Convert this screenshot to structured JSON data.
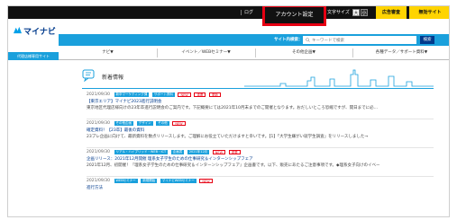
{
  "topbar": {
    "login": "ログ",
    "account": "アカウント設定",
    "font_size_label": "文字サイズ",
    "size_large": "大",
    "size_small": "小",
    "ad_button": "広告審査",
    "other_button": "無効サイト"
  },
  "header": {
    "logo_text": "マイナビ",
    "site_label": "代理店様専用サイト",
    "search_label": "サイト内検索：",
    "search_placeholder": "キーワードで検索",
    "search_button": "検索"
  },
  "nav": [
    {
      "label": "ナビ▼"
    },
    {
      "label": "イベント／WEBセミナー▼"
    },
    {
      "label": "その他企画▼"
    },
    {
      "label": "各種データ／サポート資料▼"
    }
  ],
  "news": {
    "title": "新着情報",
    "items": [
      {
        "date": "2021/09/30",
        "tags": [
          {
            "text": "新卒マーケティング課",
            "style": "blue"
          },
          {
            "text": "サポート資料",
            "style": "blue"
          },
          {
            "text": "NEW",
            "style": "red"
          },
          {
            "text": "重要",
            "style": "red"
          },
          {
            "text": "更新",
            "style": "red"
          }
        ],
        "title": "【東京エリア】マイナビ2023進行説明会",
        "body": "東京地区代理店様向けの23年卒進行説明会のご案内です。下記概要にては2021年10月末までのご開催となります。おだしいところ恐縮ですが、開日までに必…"
      },
      {
        "date": "2021/09/30",
        "tags": [
          {
            "text": "その他企画",
            "style": "blue"
          },
          {
            "text": "デザイン",
            "style": "blue"
          },
          {
            "text": "その他",
            "style": "blue"
          },
          {
            "text": "NEW",
            "style": "red"
          }
        ],
        "title": "確定資料！【23卒】最後の資料",
        "body": "23プレ企画に向けて、最新資料を数点リリースします。ご理解にお役立ていただけますと幸いです。【1】「大学生嫌がい就学生調査」をリリースしました→"
      },
      {
        "date": "2021/09/30",
        "tags": [
          {
            "text": "リアル・ハイブリッド・WEB・ICT",
            "style": "blue"
          },
          {
            "text": "企画書",
            "style": "blue"
          },
          {
            "text": "2021年12月",
            "style": "blue"
          },
          {
            "text": "NEW",
            "style": "red"
          },
          {
            "text": "重要",
            "style": "red"
          }
        ],
        "title": "企画リリース：2021年12月開催 理系女子学生のための仕事研究＆インターンシップフェア",
        "body": "2021年12月、初開催！『理系女子学生のための仕事研究＆インターンシップフェア』企画書です。以下、販売にあたるご注意事項です。◆理系女子向けのイベー"
      },
      {
        "date": "2021/09/30",
        "tags": [
          {
            "text": "WEBセミナー",
            "style": "blue"
          },
          {
            "text": "新規開始",
            "style": "blue"
          },
          {
            "text": "マイナビWEBセミナー",
            "style": "blue"
          },
          {
            "text": "NEW",
            "style": "red"
          }
        ],
        "title": "進行方法",
        "body": ""
      }
    ]
  },
  "colors": {
    "accent": "#1aa0dc",
    "brand": "#003a8c",
    "highlight": "#e60012",
    "yellow": "#ffd400"
  }
}
